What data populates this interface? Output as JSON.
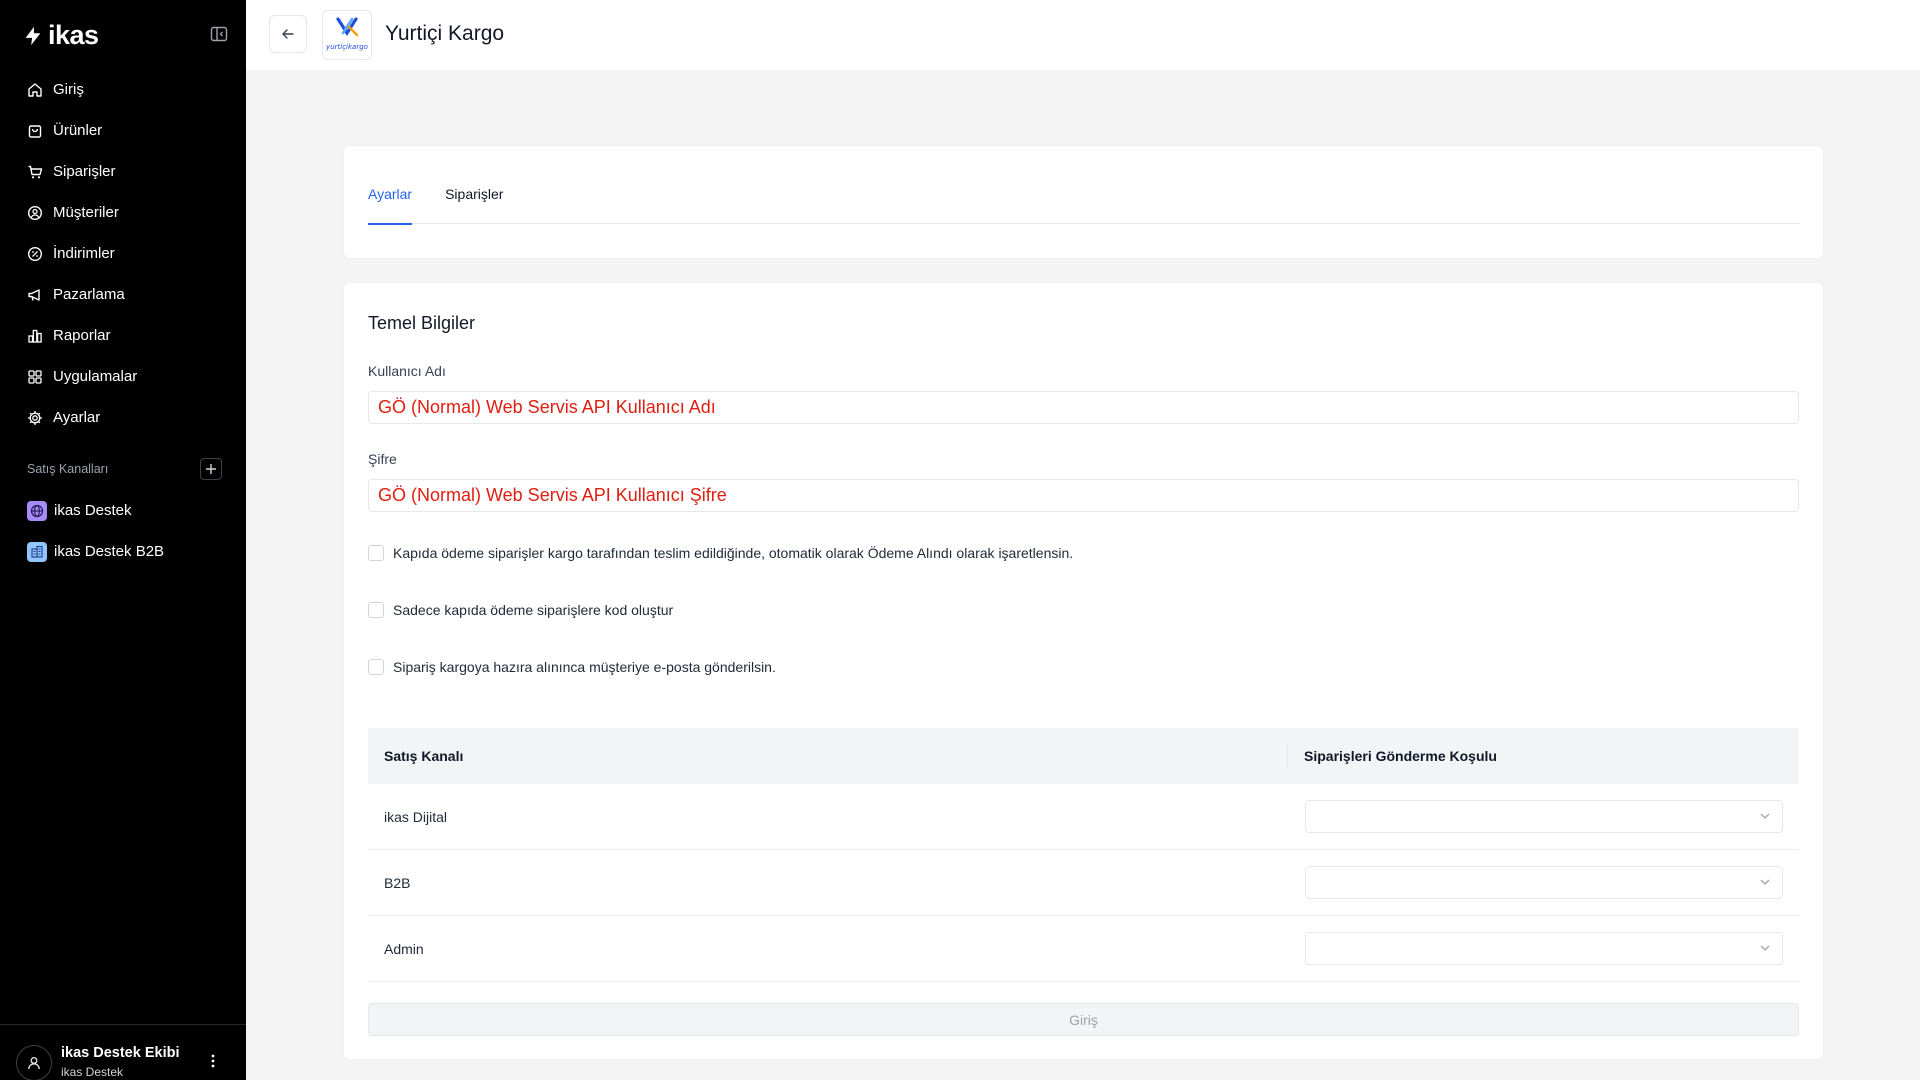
{
  "sidebar": {
    "brand": "ikas",
    "nav": [
      {
        "label": "Giriş",
        "icon": "home-icon"
      },
      {
        "label": "Ürünler",
        "icon": "bag-icon"
      },
      {
        "label": "Siparişler",
        "icon": "cart-icon"
      },
      {
        "label": "Müşteriler",
        "icon": "user-circle-icon"
      },
      {
        "label": "İndirimler",
        "icon": "discount-icon"
      },
      {
        "label": "Pazarlama",
        "icon": "megaphone-icon"
      },
      {
        "label": "Raporlar",
        "icon": "chart-icon"
      },
      {
        "label": "Uygulamalar",
        "icon": "grid-icon"
      },
      {
        "label": "Ayarlar",
        "icon": "gear-icon"
      }
    ],
    "channels_label": "Satış Kanalları",
    "channels": [
      {
        "label": "ikas Destek",
        "icon": "globe-icon",
        "color": "#a78bfa"
      },
      {
        "label": "ikas Destek B2B",
        "icon": "building-icon",
        "color": "#93c5fd"
      }
    ],
    "user": {
      "name": "ikas Destek Ekibi",
      "org": "ikas Destek"
    }
  },
  "header": {
    "title": "Yurtiçi Kargo",
    "logo_text": "yurtiçikargo"
  },
  "tabs": [
    {
      "label": "Ayarlar",
      "active": true
    },
    {
      "label": "Siparişler",
      "active": false
    }
  ],
  "form": {
    "section_title": "Temel Bilgiler",
    "username_label": "Kullanıcı Adı",
    "username_value": "GÖ (Normal) Web Servis API Kullanıcı Adı",
    "password_label": "Şifre",
    "password_value": "GÖ (Normal) Web Servis API Kullanıcı Şifre",
    "checkboxes": [
      {
        "label": "Kapıda ödeme siparişler kargo tarafından teslim edildiğinde, otomatik olarak Ödeme Alındı olarak işaretlensin.",
        "checked": false
      },
      {
        "label": "Sadece kapıda ödeme siparişlere kod oluştur",
        "checked": false
      },
      {
        "label": "Sipariş kargoya hazıra alınınca müşteriye e-posta gönderilsin.",
        "checked": false
      }
    ],
    "table": {
      "headers": [
        "Satış Kanalı",
        "Siparişleri Gönderme Koşulu"
      ],
      "rows": [
        {
          "channel": "ikas Dijital",
          "condition": ""
        },
        {
          "channel": "B2B",
          "condition": ""
        },
        {
          "channel": "Admin",
          "condition": ""
        }
      ]
    },
    "submit_label": "Giriş"
  },
  "colors": {
    "accent": "#2563eb",
    "highlight_text": "#e01e12",
    "sidebar_bg": "#000000"
  }
}
